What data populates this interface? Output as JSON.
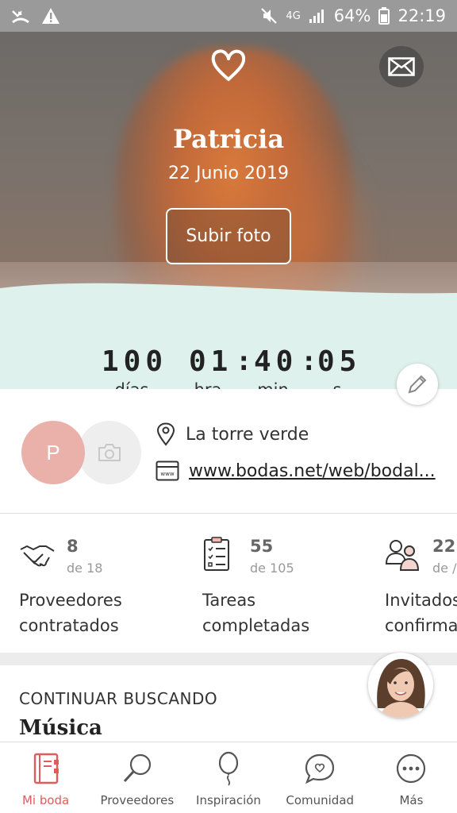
{
  "statusbar": {
    "battery": "64%",
    "time": "22:19",
    "network": "4G"
  },
  "hero": {
    "name": "Patricia",
    "date": "22 Junio 2019",
    "upload_label": "Subir foto"
  },
  "countdown": {
    "days": "100",
    "hours": "01",
    "minutes": "40",
    "seconds": "05",
    "days_label": "días",
    "hours_label": "hra",
    "minutes_label": "min",
    "seconds_label": "s"
  },
  "profile": {
    "initial": "P",
    "location": "La torre verde",
    "website": "www.bodas.net/web/bodal..."
  },
  "stats": [
    {
      "value": "8",
      "total": "de 18",
      "label_1": "Proveedores",
      "label_2": "contratados",
      "icon": "handshake-icon"
    },
    {
      "value": "55",
      "total": "de 105",
      "label_1": "Tareas",
      "label_2": "completadas",
      "icon": "checklist-icon"
    },
    {
      "value": "22",
      "total": "de /",
      "label_1": "Invitados",
      "label_2": "confirma",
      "icon": "guests-icon"
    }
  ],
  "continue": {
    "title": "CONTINUAR BUSCANDO",
    "subtitle": "Música"
  },
  "nav": [
    {
      "label": "Mi boda",
      "icon": "notebook-icon",
      "active": true
    },
    {
      "label": "Proveedores",
      "icon": "search-icon"
    },
    {
      "label": "Inspiración",
      "icon": "balloon-icon"
    },
    {
      "label": "Comunidad",
      "icon": "chat-heart-icon"
    },
    {
      "label": "Más",
      "icon": "more-icon"
    }
  ],
  "colors": {
    "accent": "#e25b5b",
    "mint": "#dff1ec",
    "avatar": "#eab0aa"
  }
}
